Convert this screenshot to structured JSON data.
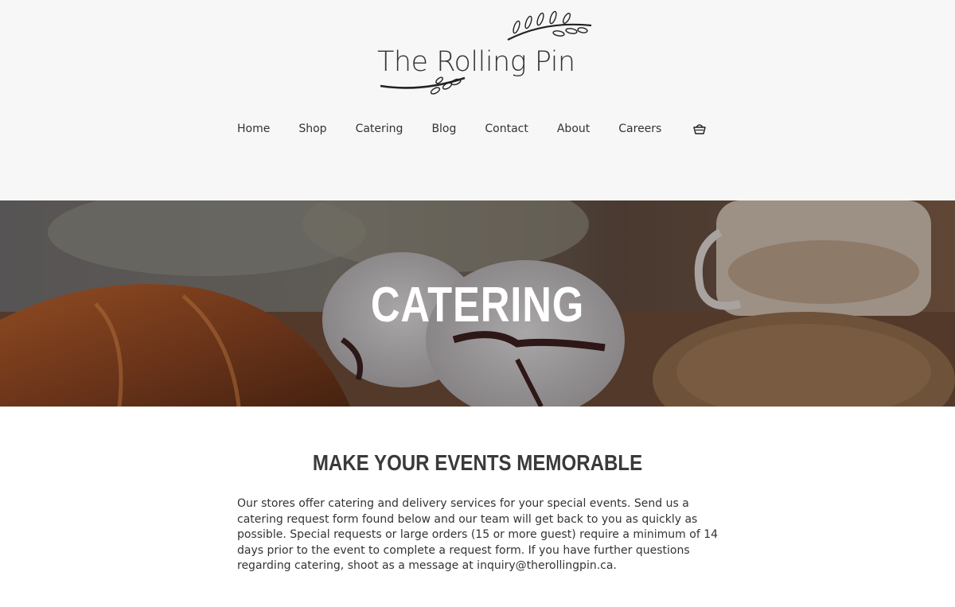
{
  "brand": {
    "name": "The Rolling Pin"
  },
  "nav": {
    "items": [
      "Home",
      "Shop",
      "Catering",
      "Blog",
      "Contact",
      "About",
      "Careers"
    ],
    "cart_icon": "basket-icon"
  },
  "hero": {
    "title": "CATERING"
  },
  "content": {
    "heading": "MAKE YOUR EVENTS MEMORABLE",
    "paragraph": "Our stores offer catering and delivery services for your special events. Send us a catering request form found below and our team will get back to you as quickly as possible. Special requests or large orders (15 or more guest) require a minimum of 14 days prior to the event to complete a request form. If you have further questions regarding catering, shoot as a message at inquiry@therollingpin.ca."
  },
  "colors": {
    "header_bg": "#f7f7f7",
    "text": "#333333",
    "hero_text": "#ffffff"
  }
}
